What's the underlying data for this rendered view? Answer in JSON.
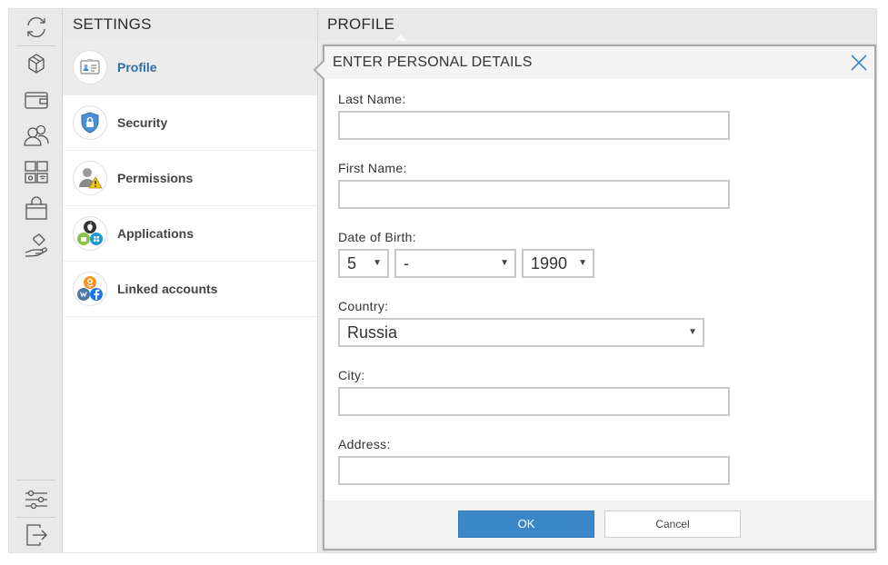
{
  "settings": {
    "title": "SETTINGS",
    "items": [
      {
        "label": "Profile",
        "icon": "id-card-icon",
        "active": true
      },
      {
        "label": "Security",
        "icon": "shield-lock-icon",
        "active": false
      },
      {
        "label": "Permissions",
        "icon": "user-warning-icon",
        "active": false
      },
      {
        "label": "Applications",
        "icon": "app-platforms-icon",
        "active": false
      },
      {
        "label": "Linked accounts",
        "icon": "social-networks-icon",
        "active": false
      }
    ]
  },
  "profile": {
    "title": "PROFILE"
  },
  "dialog": {
    "title": "ENTER PERSONAL DETAILS",
    "last_name": {
      "label": "Last Name:",
      "value": ""
    },
    "first_name": {
      "label": "First Name:",
      "value": ""
    },
    "dob": {
      "label": "Date of Birth:",
      "day": "5",
      "month": "-",
      "year": "1990"
    },
    "country": {
      "label": "Country:",
      "value": "Russia"
    },
    "city": {
      "label": "City:",
      "value": ""
    },
    "address": {
      "label": "Address:",
      "value": ""
    },
    "ok_label": "OK",
    "cancel_label": "Cancel"
  },
  "rail": {
    "icons": [
      "refresh-icon",
      "box-icon",
      "wallet-icon",
      "users-icon",
      "devices-icon",
      "shop-bag-icon",
      "hand-money-icon",
      "sliders-icon",
      "logout-icon"
    ]
  },
  "colors": {
    "accent": "#3a86c8",
    "active_label": "#2f6fa3",
    "panel_bg": "#e9e9e9"
  }
}
